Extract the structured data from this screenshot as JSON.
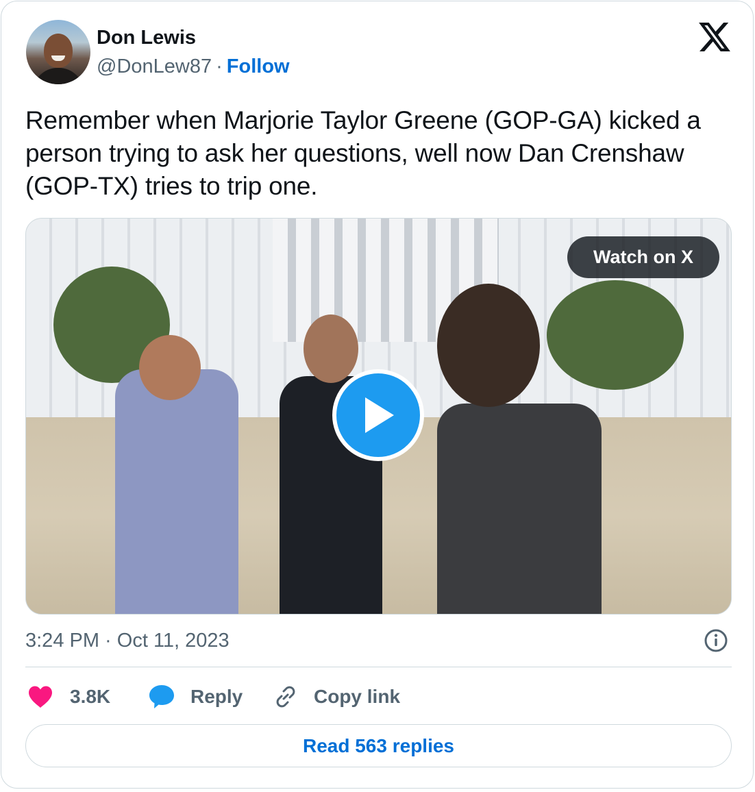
{
  "author": {
    "name": "Don Lewis",
    "handle": "@DonLew87",
    "separator": "·",
    "follow_label": "Follow"
  },
  "tweet": {
    "text": "Remember when Marjorie Taylor Greene (GOP-GA) kicked a person trying to ask her questions, well now Dan Crenshaw (GOP-TX) tries to trip one.",
    "timestamp": "3:24 PM · Oct 11, 2023"
  },
  "media": {
    "watch_label": "Watch on X"
  },
  "actions": {
    "likes": "3.8K",
    "reply_label": "Reply",
    "copy_label": "Copy link"
  },
  "read_replies_label": "Read 563 replies",
  "icons": {
    "brand": "x-logo-icon",
    "like": "heart-icon",
    "reply": "speech-bubble-icon",
    "copy": "link-icon",
    "info": "info-icon",
    "play": "play-icon"
  },
  "colors": {
    "link_blue": "#006fd6",
    "play_blue": "#1d9bf0",
    "like_red": "#f91880",
    "muted": "#536471",
    "border": "#cfd9de"
  }
}
